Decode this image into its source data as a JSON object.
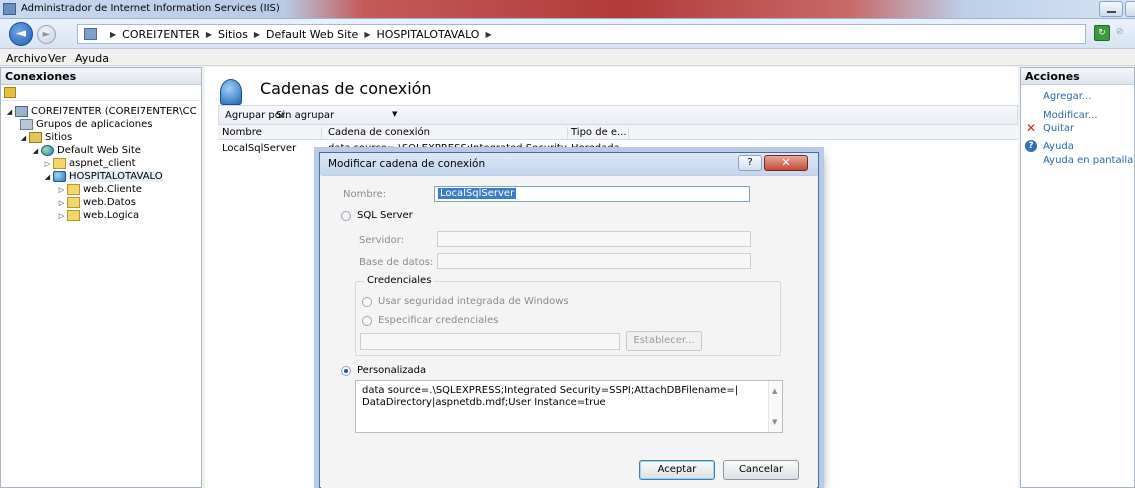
{
  "window": {
    "title": "Administrador de Internet Information Services (IIS)"
  },
  "address": {
    "crumbs": [
      "COREI7ENTER",
      "Sitios",
      "Default Web Site",
      "HOSPITALOTAVALO"
    ]
  },
  "menu": {
    "items": [
      "Archivo",
      "Ver",
      "Ayuda"
    ]
  },
  "connections": {
    "header": "Conexiones",
    "tree": [
      {
        "label": "COREI7ENTER (COREI7ENTER\\CC",
        "icon": "server-icon"
      },
      {
        "label": "Grupos de aplicaciones",
        "icon": "app-pool-icon"
      },
      {
        "label": "Sitios",
        "icon": "sites-folder-icon"
      },
      {
        "label": "Default Web Site",
        "icon": "globe-icon"
      },
      {
        "label": "aspnet_client",
        "icon": "folder-icon"
      },
      {
        "label": "HOSPITALOTAVALO",
        "icon": "application-icon"
      },
      {
        "label": "web.Cliente",
        "icon": "folder-icon"
      },
      {
        "label": "web.Datos",
        "icon": "folder-icon"
      },
      {
        "label": "web.Logica",
        "icon": "folder-icon"
      }
    ]
  },
  "main": {
    "title": "Cadenas de conexión",
    "group_label": "Agrupar por:",
    "group_value": "Sin agrupar",
    "columns": [
      "Nombre",
      "Cadena de conexión",
      "Tipo de e..."
    ],
    "rows": [
      {
        "name": "LocalSqlServer",
        "value": "data source=.\\SQLEXPRESS;Integrated Security...",
        "type": "Heredada"
      }
    ]
  },
  "dialog": {
    "title": "Modificar cadena de conexión",
    "help_button": "?",
    "close_button": "✕",
    "name_label": "Nombre:",
    "name_value": "LocalSqlServer",
    "sql_server_option": "SQL Server",
    "server_label": "Servidor:",
    "database_label": "Base de datos:",
    "credentials_legend": "Credenciales",
    "windows_auth_option": "Usar seguridad integrada de Windows",
    "specify_credentials_option": "Especificar credenciales",
    "set_button": "Establecer...",
    "custom_option": "Personalizada",
    "custom_value_line1": "data source=.\\SQLEXPRESS;Integrated Security=SSPI;AttachDBFilename=|",
    "custom_value_line2": "DataDirectory|aspnetdb.mdf;User Instance=true",
    "ok_button": "Aceptar",
    "cancel_button": "Cancelar"
  },
  "actions": {
    "header": "Acciones",
    "items": [
      "Agregar...",
      "Modificar...",
      "Quitar",
      "Ayuda",
      "Ayuda en pantalla"
    ]
  },
  "colors": {
    "link": "#2a68b0",
    "remove": "#c0281c",
    "selection": "#3d7cc9"
  }
}
